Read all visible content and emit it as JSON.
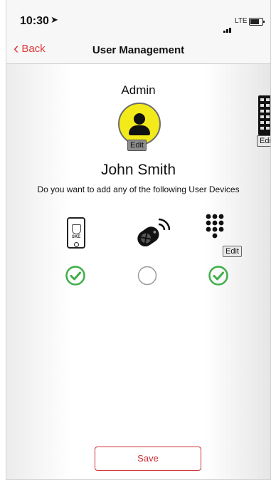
{
  "status_bar": {
    "time": "10:30",
    "location_icon": "location-arrow-icon",
    "carrier": "LTE",
    "battery_icon": "battery-icon"
  },
  "nav": {
    "back_label": "Back",
    "title": "User Management"
  },
  "user": {
    "role": "Admin",
    "name": "John Smith",
    "avatar_edit_label": "Edit"
  },
  "keypad_top": {
    "edit_label": "Edit"
  },
  "prompt": "Do you want to add any of the following User Devices",
  "devices": [
    {
      "name": "phone",
      "label": "SKE",
      "selected": true
    },
    {
      "name": "key-fob",
      "selected": false
    },
    {
      "name": "keypad",
      "selected": true,
      "edit_label": "Edit"
    }
  ],
  "save_label": "Save",
  "colors": {
    "accent": "#d02e33",
    "check": "#3fae49",
    "avatar_bg": "#f3ea1b"
  }
}
